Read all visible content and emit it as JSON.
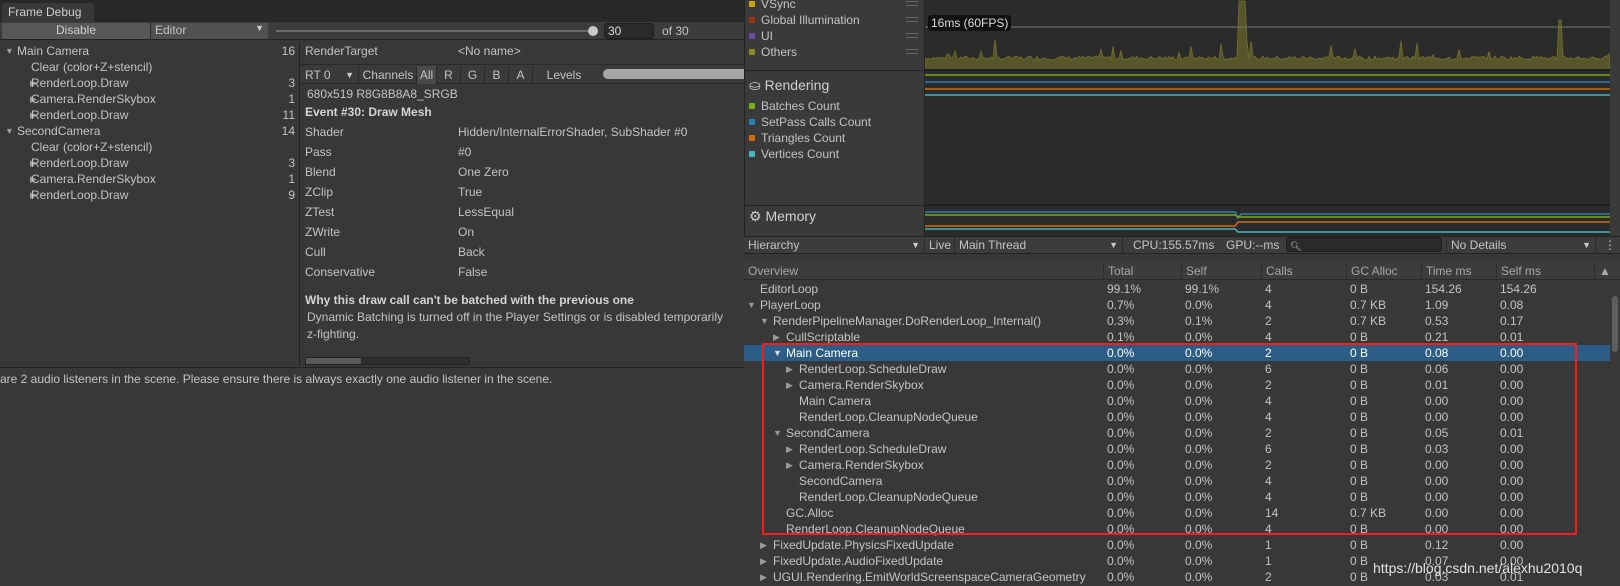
{
  "frame_debug": {
    "tab": "Frame Debug",
    "disable_label": "Disable",
    "target": "Editor",
    "event_current": "30",
    "event_total": "of 30",
    "event_slider_fraction": 1.0,
    "events": [
      {
        "label": "Main Camera",
        "count": "16",
        "level": 0,
        "expand": "open"
      },
      {
        "label": "Clear (color+Z+stencil)",
        "count": "",
        "level": 1,
        "expand": "none"
      },
      {
        "label": "RenderLoop.Draw",
        "count": "3",
        "level": 1,
        "expand": "closed"
      },
      {
        "label": "Camera.RenderSkybox",
        "count": "1",
        "level": 1,
        "expand": "closed"
      },
      {
        "label": "RenderLoop.Draw",
        "count": "11",
        "level": 1,
        "expand": "closed"
      },
      {
        "label": "SecondCamera",
        "count": "14",
        "level": 0,
        "expand": "open"
      },
      {
        "label": "Clear (color+Z+stencil)",
        "count": "",
        "level": 1,
        "expand": "none"
      },
      {
        "label": "RenderLoop.Draw",
        "count": "3",
        "level": 1,
        "expand": "closed"
      },
      {
        "label": "Camera.RenderSkybox",
        "count": "1",
        "level": 1,
        "expand": "closed"
      },
      {
        "label": "RenderLoop.Draw",
        "count": "9",
        "level": 1,
        "expand": "closed"
      }
    ],
    "render_target_label": "RenderTarget",
    "render_target_value": "<No name>",
    "rt_select": "RT 0",
    "channels_label": "Channels",
    "channels": [
      "All",
      "R",
      "G",
      "B",
      "A"
    ],
    "levels_label": "Levels",
    "format": "680x519 R8G8B8A8_SRGB",
    "event_title": "Event #30: Draw Mesh",
    "props": [
      {
        "k": "Shader",
        "v": "Hidden/InternalErrorShader, SubShader #0"
      },
      {
        "k": "Pass",
        "v": "#0"
      },
      {
        "k": "Blend",
        "v": "One Zero"
      },
      {
        "k": "ZClip",
        "v": "True"
      },
      {
        "k": "ZTest",
        "v": "LessEqual"
      },
      {
        "k": "ZWrite",
        "v": "On"
      },
      {
        "k": "Cull",
        "v": "Back"
      },
      {
        "k": "Conservative",
        "v": "False"
      }
    ],
    "batch_title": "Why this draw call can't be batched with the previous one",
    "batch_reason_1": "Dynamic Batching is turned off in the Player Settings or is disabled temporarily",
    "batch_reason_2": "z-fighting."
  },
  "console_message": "are 2 audio listeners in the scene. Please ensure there is always exactly one audio listener in the scene.",
  "profiler": {
    "cpu_legend": [
      {
        "label": "VSync",
        "color": "#c8a400"
      },
      {
        "label": "Global Illumination",
        "color": "#9c3010"
      },
      {
        "label": "UI",
        "color": "#6a4aa8"
      },
      {
        "label": "Others",
        "color": "#8a8a20"
      }
    ],
    "fps_label": "16ms (60FPS)",
    "rendering_title": "Rendering",
    "rendering_legend": [
      {
        "label": "Batches Count",
        "color": "#7ea818"
      },
      {
        "label": "SetPass Calls Count",
        "color": "#2e7eb0"
      },
      {
        "label": "Triangles Count",
        "color": "#d06a10"
      },
      {
        "label": "Vertices Count",
        "color": "#48b4c0"
      }
    ],
    "memory_title": "Memory",
    "toolbar": {
      "view": "Hierarchy",
      "live": "Live",
      "thread": "Main Thread",
      "cpu": "CPU:155.57ms",
      "gpu": "GPU:--ms",
      "search_placeholder": "",
      "details": "No Details"
    },
    "columns": [
      "Overview",
      "Total",
      "Self",
      "Calls",
      "GC Alloc",
      "Time ms",
      "Self ms"
    ],
    "rows": [
      {
        "name": "EditorLoop",
        "level": 0,
        "expand": "none",
        "total": "99.1%",
        "self": "99.1%",
        "calls": "4",
        "gc": "0 B",
        "time": "154.26",
        "selfms": "154.26"
      },
      {
        "name": "PlayerLoop",
        "level": 0,
        "expand": "open",
        "total": "0.7%",
        "self": "0.0%",
        "calls": "4",
        "gc": "0.7 KB",
        "time": "1.09",
        "selfms": "0.08"
      },
      {
        "name": "RenderPipelineManager.DoRenderLoop_Internal()",
        "level": 1,
        "expand": "open",
        "total": "0.3%",
        "self": "0.1%",
        "calls": "2",
        "gc": "0.7 KB",
        "time": "0.53",
        "selfms": "0.17"
      },
      {
        "name": "CullScriptable",
        "level": 2,
        "expand": "closed",
        "total": "0.1%",
        "self": "0.0%",
        "calls": "4",
        "gc": "0 B",
        "time": "0.21",
        "selfms": "0.01"
      },
      {
        "name": "Main Camera",
        "level": 2,
        "expand": "open",
        "selected": true,
        "total": "0.0%",
        "self": "0.0%",
        "calls": "2",
        "gc": "0 B",
        "time": "0.08",
        "selfms": "0.00"
      },
      {
        "name": "RenderLoop.ScheduleDraw",
        "level": 3,
        "expand": "closed",
        "total": "0.0%",
        "self": "0.0%",
        "calls": "6",
        "gc": "0 B",
        "time": "0.06",
        "selfms": "0.00"
      },
      {
        "name": "Camera.RenderSkybox",
        "level": 3,
        "expand": "closed",
        "total": "0.0%",
        "self": "0.0%",
        "calls": "2",
        "gc": "0 B",
        "time": "0.01",
        "selfms": "0.00"
      },
      {
        "name": "Main Camera",
        "level": 3,
        "expand": "none",
        "total": "0.0%",
        "self": "0.0%",
        "calls": "4",
        "gc": "0 B",
        "time": "0.00",
        "selfms": "0.00"
      },
      {
        "name": "RenderLoop.CleanupNodeQueue",
        "level": 3,
        "expand": "none",
        "total": "0.0%",
        "self": "0.0%",
        "calls": "4",
        "gc": "0 B",
        "time": "0.00",
        "selfms": "0.00"
      },
      {
        "name": "SecondCamera",
        "level": 2,
        "expand": "open",
        "total": "0.0%",
        "self": "0.0%",
        "calls": "2",
        "gc": "0 B",
        "time": "0.05",
        "selfms": "0.01"
      },
      {
        "name": "RenderLoop.ScheduleDraw",
        "level": 3,
        "expand": "closed",
        "total": "0.0%",
        "self": "0.0%",
        "calls": "6",
        "gc": "0 B",
        "time": "0.03",
        "selfms": "0.00"
      },
      {
        "name": "Camera.RenderSkybox",
        "level": 3,
        "expand": "closed",
        "total": "0.0%",
        "self": "0.0%",
        "calls": "2",
        "gc": "0 B",
        "time": "0.00",
        "selfms": "0.00"
      },
      {
        "name": "SecondCamera",
        "level": 3,
        "expand": "none",
        "total": "0.0%",
        "self": "0.0%",
        "calls": "4",
        "gc": "0 B",
        "time": "0.00",
        "selfms": "0.00"
      },
      {
        "name": "RenderLoop.CleanupNodeQueue",
        "level": 3,
        "expand": "none",
        "total": "0.0%",
        "self": "0.0%",
        "calls": "4",
        "gc": "0 B",
        "time": "0.00",
        "selfms": "0.00"
      },
      {
        "name": "GC.Alloc",
        "level": 2,
        "expand": "none",
        "total": "0.0%",
        "self": "0.0%",
        "calls": "14",
        "gc": "0.7 KB",
        "time": "0.00",
        "selfms": "0.00"
      },
      {
        "name": "RenderLoop.CleanupNodeQueue",
        "level": 2,
        "expand": "none",
        "total": "0.0%",
        "self": "0.0%",
        "calls": "4",
        "gc": "0 B",
        "time": "0.00",
        "selfms": "0.00"
      },
      {
        "name": "FixedUpdate.PhysicsFixedUpdate",
        "level": 1,
        "expand": "closed",
        "total": "0.0%",
        "self": "0.0%",
        "calls": "1",
        "gc": "0 B",
        "time": "0.12",
        "selfms": "0.00"
      },
      {
        "name": "FixedUpdate.AudioFixedUpdate",
        "level": 1,
        "expand": "closed",
        "total": "0.0%",
        "self": "0.0%",
        "calls": "1",
        "gc": "0 B",
        "time": "0.07",
        "selfms": "0.00"
      },
      {
        "name": "UGUI.Rendering.EmitWorldScreenspaceCameraGeometry",
        "level": 1,
        "expand": "closed",
        "total": "0.0%",
        "self": "0.0%",
        "calls": "2",
        "gc": "0 B",
        "time": "0.03",
        "selfms": "0.01"
      }
    ],
    "highlight_color": "#ff1a1a",
    "selected_color": "#2c5d87"
  },
  "watermark": "https://blog.csdn.net/alexhu2010q"
}
